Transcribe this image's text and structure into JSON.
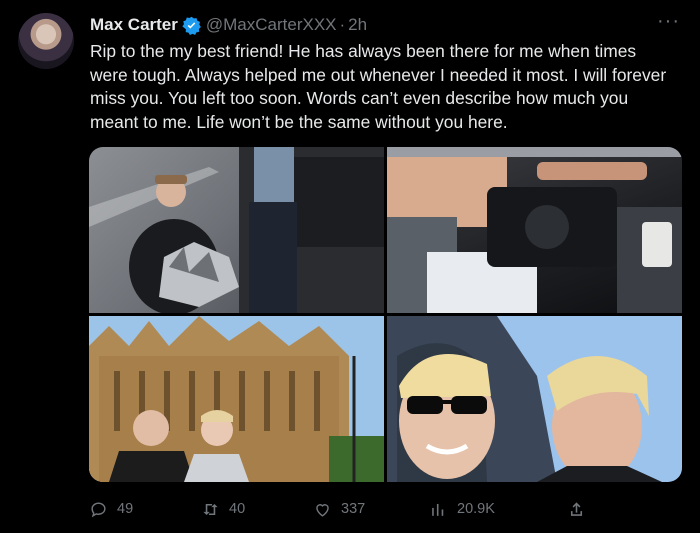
{
  "tweet": {
    "author_name": "Max Carter",
    "handle": "@MaxCarterXXX",
    "separator": "·",
    "time": "2h",
    "text": "Rip to the my best friend! He has always been there for me when times were tough. Always helped me out whenever I needed it most. I will forever miss you. You left too soon. Words can’t even describe how much you meant to me. Life won’t be the same without you here.",
    "more_icon": "···"
  },
  "media": [
    {
      "icon": "photo"
    },
    {
      "icon": "photo"
    },
    {
      "icon": "photo"
    },
    {
      "icon": "photo"
    }
  ],
  "actions": {
    "replies": "49",
    "retweets": "40",
    "likes": "337",
    "views": "20.9K"
  },
  "colors": {
    "background": "#000000",
    "text": "#e7e9ea",
    "muted": "#71767b",
    "verified": "#1d9bf0"
  }
}
